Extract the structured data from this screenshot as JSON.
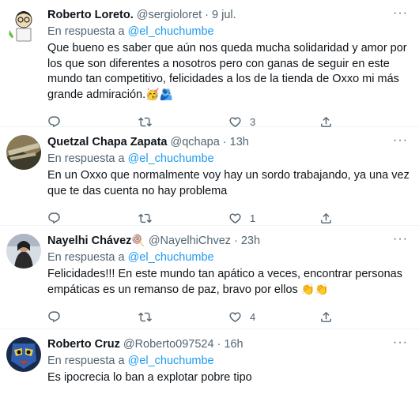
{
  "reply_prefix": "En respuesta a",
  "tweets": [
    {
      "name": "Roberto Loreto.",
      "handle": "@sergioloret",
      "time": "9 jul.",
      "mention": "@el_chuchumbe",
      "text": "Que bueno es saber que aún nos queda mucha solidaridad y amor por los que son diferentes a nosotros pero con ganas de seguir en este mundo tan competitivo, felicidades a los de la tienda de Oxxo mi más grande admiración.",
      "emoji": "🥳🫂",
      "replies": "",
      "retweets": "",
      "likes": "3"
    },
    {
      "name": "Quetzal Chapa Zapata",
      "handle": "@qchapa",
      "time": "13h",
      "mention": "@el_chuchumbe",
      "text": "En un Oxxo que normalmente voy hay un sordo trabajando, ya una vez que te das cuenta no hay problema",
      "emoji": "",
      "replies": "",
      "retweets": "",
      "likes": "1"
    },
    {
      "name": "Nayelhi Chávez",
      "name_emoji": "🍭",
      "handle": "@NayelhiChvez",
      "time": "23h",
      "mention": "@el_chuchumbe",
      "text": "Felicidades!!! En este mundo tan apático a veces, encontrar personas empáticas es un remanso de paz, bravo por ellos",
      "emoji": "👏👏",
      "replies": "",
      "retweets": "",
      "likes": "4"
    },
    {
      "name": "Roberto Cruz",
      "handle": "@Roberto097524",
      "time": "16h",
      "mention": "@el_chuchumbe",
      "text": "Es ipocrecia lo ban a explotar pobre tipo",
      "emoji": "",
      "replies": "",
      "retweets": "",
      "likes": ""
    }
  ],
  "colors": {
    "link": "#1d9bf0",
    "secondary": "#536471",
    "divider": "#eff3f4"
  },
  "icons": [
    "reply-icon",
    "retweet-icon",
    "like-icon",
    "share-icon",
    "more-icon"
  ]
}
